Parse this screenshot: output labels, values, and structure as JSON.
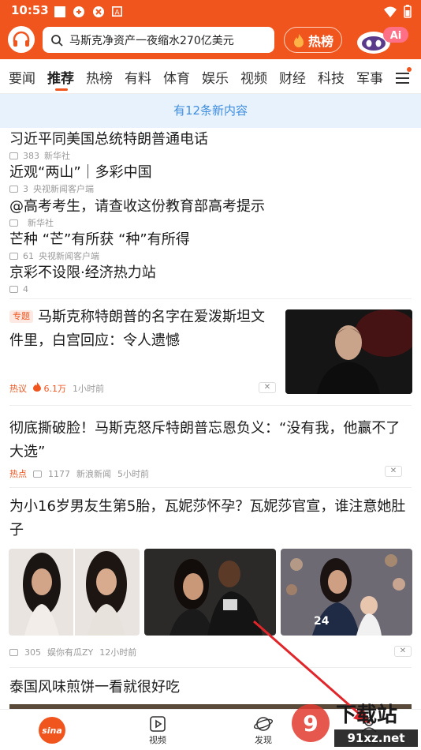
{
  "status": {
    "time": "10:53"
  },
  "header": {
    "search_text": "马斯克净资产一夜缩水270亿美元",
    "hot_label": "热榜",
    "ai_label": "Ai"
  },
  "tabs": [
    "要闻",
    "推荐",
    "热榜",
    "有料",
    "体育",
    "娱乐",
    "视频",
    "财经",
    "科技",
    "军事"
  ],
  "notice": "有12条新内容",
  "short_items": [
    {
      "title": "习近平同美国总统特朗普通电话",
      "comments": "383",
      "source": "新华社"
    },
    {
      "title": "近观“两山”｜多彩中国",
      "comments": "3",
      "source": "央视新闻客户端"
    },
    {
      "title": "@高考考生，请查收这份教育部高考提示",
      "comments": "",
      "source": "新华社"
    },
    {
      "title": "芒种 “芒”有所获 “种”有所得",
      "comments": "61",
      "source": "央视新闻客户端"
    },
    {
      "title": "京彩不设限·经济热力站",
      "comments": "4",
      "source": ""
    }
  ],
  "article1": {
    "tag": "专题",
    "title": "马斯克称特朗普的名字在爱泼斯坦文件里，白宫回应：令人遗憾",
    "hot_tag": "热议",
    "heat": "6.1万",
    "time": "1小时前",
    "close": "✕"
  },
  "article2": {
    "title": "彻底撕破脸！马斯克怒斥特朗普忘恩负义：“没有我，他赢不了大选”",
    "hot_tag": "热点",
    "comments": "1177",
    "source": "新浪新闻",
    "time": "5小时前",
    "close": "✕"
  },
  "article3": {
    "title": "为小16岁男友生第5胎，瓦妮莎怀孕？瓦妮莎官宣，谁注意她肚子",
    "comments": "305",
    "source": "娱你有瓜ZY",
    "time": "12小时前",
    "close": "✕"
  },
  "article4": {
    "title": "泰国风味煎饼一看就很好吃"
  },
  "bottom_nav": {
    "home_label": "sina",
    "video_label": "视频",
    "discover_label": "发现",
    "mine_label": "我的"
  },
  "watermark": {
    "main": "下载站",
    "url": "91xz.net"
  }
}
